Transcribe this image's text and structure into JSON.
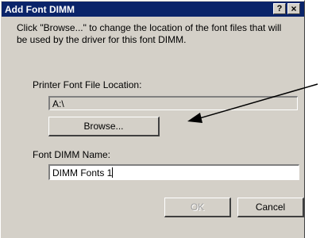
{
  "dialog": {
    "title": "Add Font DIMM",
    "help_label": "?",
    "close_label": "×",
    "instruction": "Click \"Browse...\" to change the location of the font files that will be used by the driver for this font DIMM.",
    "location_label": "Printer Font File Location:",
    "location_value": "A:\\",
    "browse_label": "Browse...",
    "name_label": "Font DIMM Name:",
    "name_value": "DIMM Fonts 1",
    "ok_label": "OK",
    "cancel_label": "Cancel"
  },
  "colors": {
    "titlebar": "#0a246a",
    "face": "#d4d0c8"
  },
  "icons": {
    "help": "help-icon",
    "close": "close-icon",
    "annotation": "annotation-arrow"
  }
}
